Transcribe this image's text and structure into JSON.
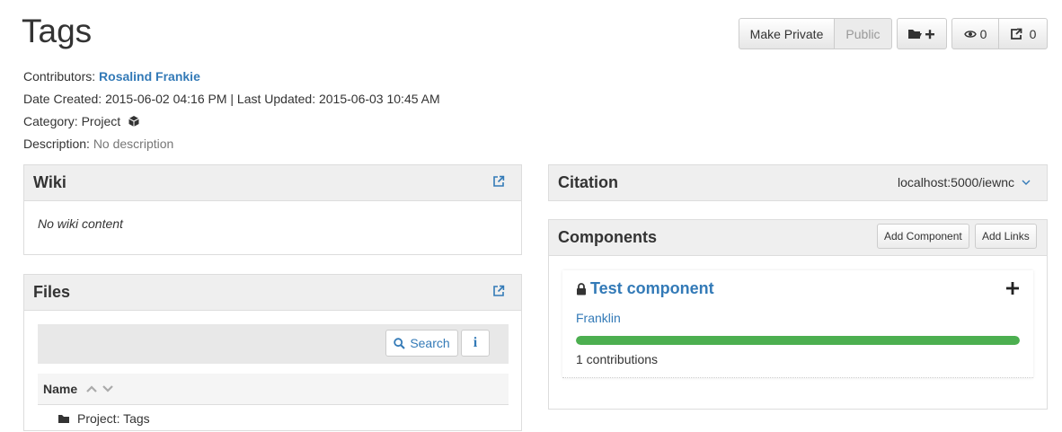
{
  "page": {
    "title": "Tags"
  },
  "header_actions": {
    "make_private": "Make Private",
    "public": "Public",
    "watch_count": "0",
    "fork_count": "0"
  },
  "meta": {
    "contributors_label": "Contributors:",
    "contributor_name": "Rosalind Frankie",
    "date_created_label": "Date Created:",
    "date_created": "2015-06-02 04:16 PM",
    "separator": "|",
    "last_updated_label": "Last Updated:",
    "last_updated": "2015-06-03 10:45 AM",
    "category_label": "Category:",
    "category": "Project",
    "description_label": "Description:",
    "description": "No description"
  },
  "wiki": {
    "title": "Wiki",
    "content": "No wiki content"
  },
  "files": {
    "title": "Files",
    "search_label": "Search",
    "info_label": "i",
    "column_name": "Name",
    "first_row": "Project: Tags"
  },
  "citation": {
    "title": "Citation",
    "url": "localhost:5000/iewnc"
  },
  "components": {
    "title": "Components",
    "add_component": "Add Component",
    "add_links": "Add Links",
    "item": {
      "name": "Test component",
      "contributor": "Franklin",
      "contributions_text": "1 contributions",
      "progress": 1.0
    }
  },
  "colors": {
    "link": "#337ab7",
    "progress": "#4caf50",
    "panel_heading": "#efefef"
  }
}
